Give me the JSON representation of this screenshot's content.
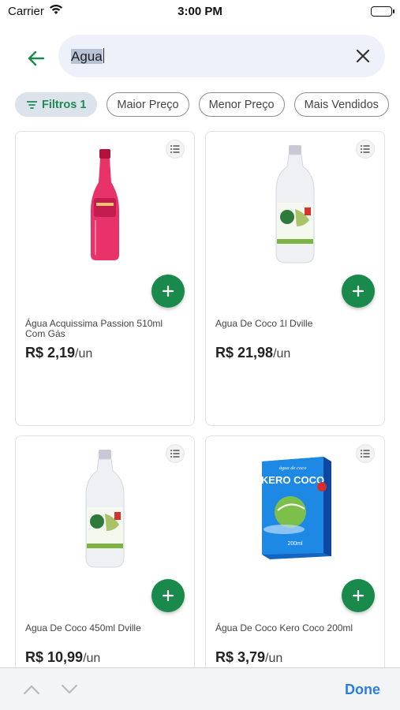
{
  "status_bar": {
    "carrier": "Carrier",
    "time": "3:00 PM"
  },
  "search": {
    "query": "Agua"
  },
  "filters": [
    {
      "label": "Filtros 1",
      "active": true
    },
    {
      "label": "Maior Preço",
      "active": false
    },
    {
      "label": "Menor Preço",
      "active": false
    },
    {
      "label": "Mais Vendidos",
      "active": false
    }
  ],
  "products": [
    {
      "name": "Água Acquissima Passion 510ml Com Gás",
      "price": "R$ 2,19",
      "unit": "/un",
      "image_icon": "pink-bottle-icon"
    },
    {
      "name": "Agua De Coco 1l Dville",
      "price": "R$ 21,98",
      "unit": "/un",
      "image_icon": "coconut-water-bottle-icon"
    },
    {
      "name": "Agua De Coco 450ml Dville",
      "price": "R$ 10,99",
      "unit": "/un",
      "image_icon": "coconut-water-bottle-icon"
    },
    {
      "name": "Água De Coco Kero Coco 200ml",
      "price": "R$ 3,79",
      "unit": "/un",
      "image_icon": "kero-coco-carton-icon"
    }
  ],
  "carton": {
    "top_text": "água de coco",
    "brand": "KERO COCO",
    "volume": "200ml"
  },
  "keyboard_toolbar": {
    "done_label": "Done"
  },
  "colors": {
    "brand_green": "#1a8a4c",
    "link_blue": "#2b7de2",
    "search_bg": "#eef1f9"
  }
}
